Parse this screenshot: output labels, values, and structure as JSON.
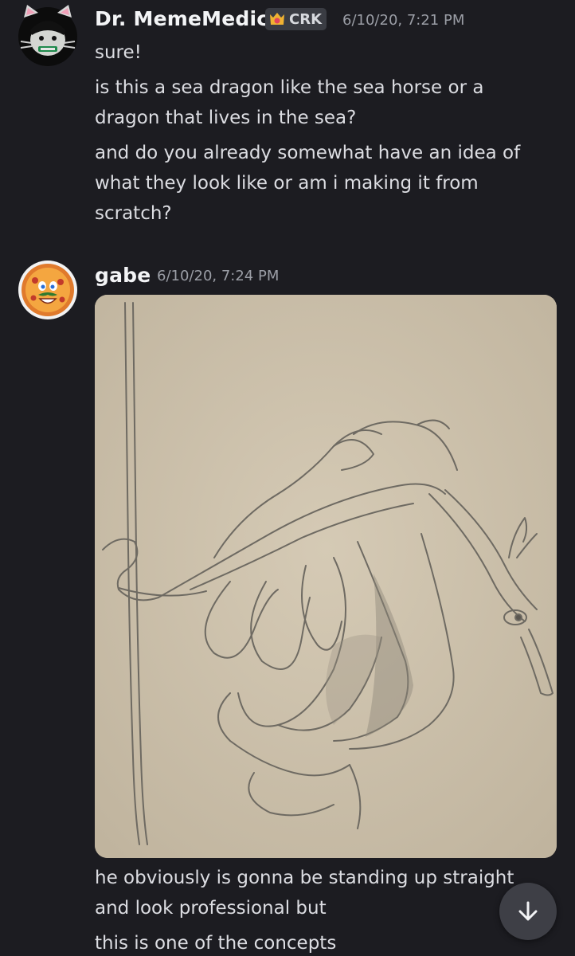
{
  "messages": [
    {
      "author": "Dr. MemeMedic",
      "badge": "CRK",
      "timestamp": "6/10/20, 7:21 PM",
      "lines": [
        "sure!",
        "is this a sea dragon like the sea horse or a",
        "dragon that lives in the sea?",
        "and do you already somewhat have an idea of",
        "what they look like or am i making it from",
        "scratch?"
      ]
    },
    {
      "author": "gabe",
      "timestamp": "6/10/20, 7:24 PM",
      "lines": [
        "he obviously is gonna be standing up straight",
        "and look professional but",
        "this is one of the concepts"
      ]
    }
  ],
  "icons": {
    "badge_icon": "crown-shield-icon",
    "scroll_button_icon": "arrow-down-icon"
  },
  "colors": {
    "background": "#1c1c21",
    "username": "#f3f4f6",
    "timestamp": "#9b9ea6",
    "message_text": "#dcdde2",
    "badge_bg": "#3a3c43",
    "badge_icon": "#f0b232",
    "paper": "#cbbfa9"
  }
}
